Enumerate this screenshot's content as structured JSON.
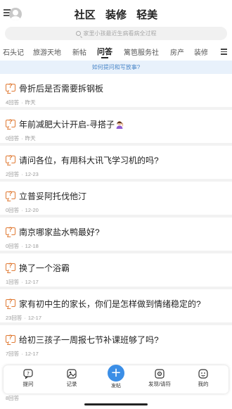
{
  "header": {
    "tabs": [
      "社区",
      "装修",
      "轻美"
    ]
  },
  "search": {
    "placeholder": "家里小孩最近生病看病全过程"
  },
  "categories": {
    "items": [
      "石头记",
      "旅游天地",
      "新帖",
      "问答",
      "篱笆服务社",
      "房产",
      "装修"
    ],
    "active": "问答"
  },
  "banner": {
    "text": "如何提问和写放事?"
  },
  "questions": [
    {
      "title": "骨折后是否需要拆钢板",
      "answers": "4回答",
      "time": "昨天"
    },
    {
      "title": "年前减肥大计开启-寻搭子",
      "answers": "0回答",
      "time": "昨天"
    },
    {
      "title": "请问各位，有用科大讯飞学习机的吗?",
      "answers": "2回答",
      "time": "12-23"
    },
    {
      "title": "立普妥阿托伐他汀",
      "answers": "0回答",
      "time": "12-20"
    },
    {
      "title": "南京哪家盐水鸭最好?",
      "answers": "0回答",
      "time": "12-18"
    },
    {
      "title": "换了一个浴霸",
      "answers": "1回答",
      "time": "12-17"
    },
    {
      "title": "家有初中生的家长，你们是怎样做到情绪稳定的?",
      "answers": "23回答",
      "time": "12-17"
    },
    {
      "title": "给初三孩子一周报七节补课班够了吗?",
      "answers": "7回答",
      "time": "12-17"
    }
  ],
  "peek_meta": "8回答",
  "bottom_bar": {
    "ask": "提问",
    "record": "记录",
    "post": "发帖",
    "discover": "发现/请符",
    "mine": "我的"
  },
  "colors": {
    "accent": "#3b8ee6",
    "question_icon": "#e07a34",
    "banner_bg": "#e8f1fb",
    "banner_text": "#4a86c8"
  }
}
